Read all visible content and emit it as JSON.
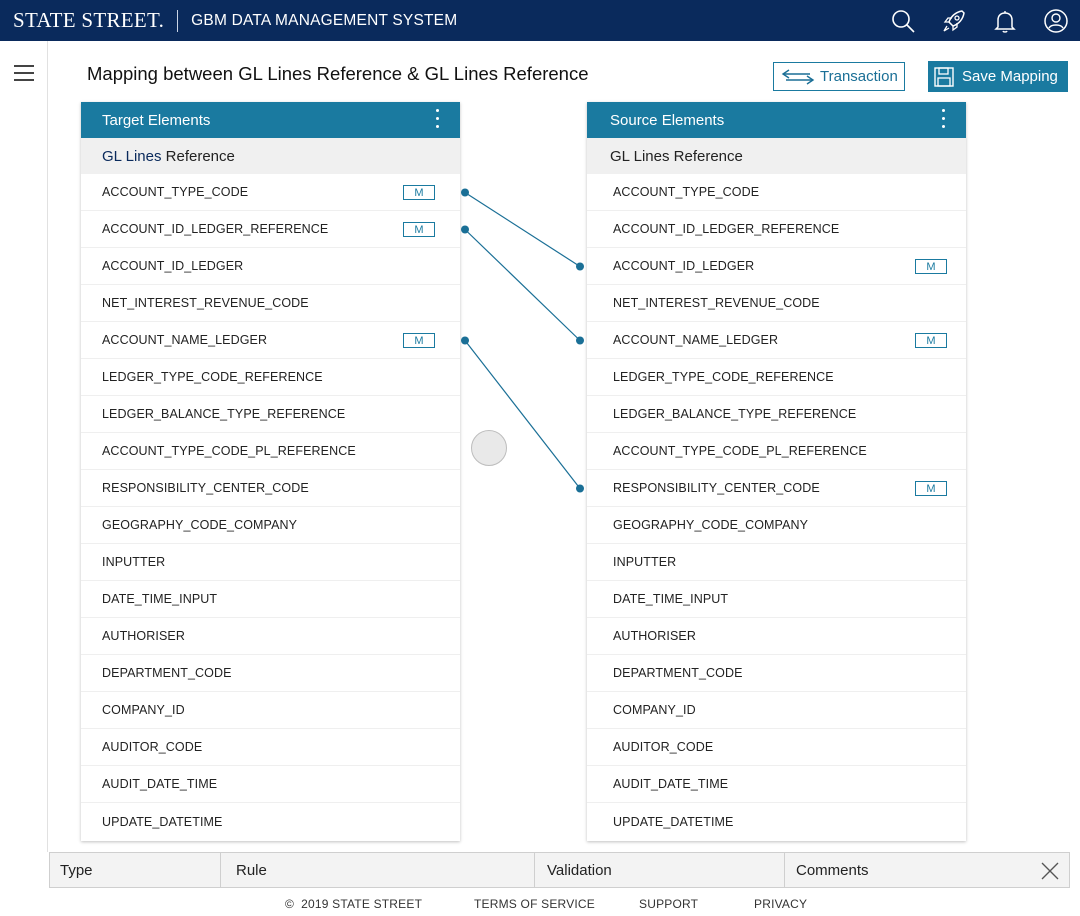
{
  "header": {
    "brand": "STATE STREET.",
    "system_name": "GBM DATA MANAGEMENT SYSTEM",
    "icons": [
      "search-icon",
      "rocket-icon",
      "bell-icon",
      "user-icon"
    ]
  },
  "page": {
    "title": "Mapping between GL Lines Reference & GL Lines Reference",
    "transaction_label": "Transaction",
    "save_label": "Save Mapping"
  },
  "target_panel": {
    "title": "Target Elements",
    "sub_prefix": "GL Lines",
    "sub_suffix": " Reference",
    "rows": [
      {
        "label": "ACCOUNT_TYPE_CODE",
        "badge": "M"
      },
      {
        "label": "ACCOUNT_ID_LEDGER_REFERENCE",
        "badge": "M"
      },
      {
        "label": "ACCOUNT_ID_LEDGER",
        "badge": ""
      },
      {
        "label": "NET_INTEREST_REVENUE_CODE",
        "badge": ""
      },
      {
        "label": "ACCOUNT_NAME_LEDGER",
        "badge": "M"
      },
      {
        "label": "LEDGER_TYPE_CODE_REFERENCE",
        "badge": ""
      },
      {
        "label": "LEDGER_BALANCE_TYPE_REFERENCE",
        "badge": ""
      },
      {
        "label": "ACCOUNT_TYPE_CODE_PL_REFERENCE",
        "badge": ""
      },
      {
        "label": "RESPONSIBILITY_CENTER_CODE",
        "badge": ""
      },
      {
        "label": "GEOGRAPHY_CODE_COMPANY",
        "badge": ""
      },
      {
        "label": "INPUTTER",
        "badge": ""
      },
      {
        "label": "DATE_TIME_INPUT",
        "badge": ""
      },
      {
        "label": "AUTHORISER",
        "badge": ""
      },
      {
        "label": "DEPARTMENT_CODE",
        "badge": ""
      },
      {
        "label": "COMPANY_ID",
        "badge": ""
      },
      {
        "label": "AUDITOR_CODE",
        "badge": ""
      },
      {
        "label": "AUDIT_DATE_TIME",
        "badge": ""
      },
      {
        "label": "UPDATE_DATETIME",
        "badge": ""
      }
    ]
  },
  "source_panel": {
    "title": "Source Elements",
    "sub": "GL Lines Reference",
    "rows": [
      {
        "label": "ACCOUNT_TYPE_CODE",
        "badge": ""
      },
      {
        "label": "ACCOUNT_ID_LEDGER_REFERENCE",
        "badge": ""
      },
      {
        "label": "ACCOUNT_ID_LEDGER",
        "badge": "M"
      },
      {
        "label": "NET_INTEREST_REVENUE_CODE",
        "badge": ""
      },
      {
        "label": "ACCOUNT_NAME_LEDGER",
        "badge": "M"
      },
      {
        "label": "LEDGER_TYPE_CODE_REFERENCE",
        "badge": ""
      },
      {
        "label": "LEDGER_BALANCE_TYPE_REFERENCE",
        "badge": ""
      },
      {
        "label": "ACCOUNT_TYPE_CODE_PL_REFERENCE",
        "badge": ""
      },
      {
        "label": "RESPONSIBILITY_CENTER_CODE",
        "badge": "M"
      },
      {
        "label": "GEOGRAPHY_CODE_COMPANY",
        "badge": ""
      },
      {
        "label": "INPUTTER",
        "badge": ""
      },
      {
        "label": "DATE_TIME_INPUT",
        "badge": ""
      },
      {
        "label": "AUTHORISER",
        "badge": ""
      },
      {
        "label": "DEPARTMENT_CODE",
        "badge": ""
      },
      {
        "label": "COMPANY_ID",
        "badge": ""
      },
      {
        "label": "AUDITOR_CODE",
        "badge": ""
      },
      {
        "label": "AUDIT_DATE_TIME",
        "badge": ""
      },
      {
        "label": "UPDATE_DATETIME",
        "badge": ""
      }
    ]
  },
  "mappings": [
    {
      "target_index": 0,
      "source_index": 2
    },
    {
      "target_index": 1,
      "source_index": 4
    },
    {
      "target_index": 4,
      "source_index": 8
    }
  ],
  "bottom_tabs": {
    "type": "Type",
    "rule": "Rule",
    "validation": "Validation",
    "comments": "Comments"
  },
  "footer": {
    "copyright": "©  2019 STATE STREET",
    "terms": "TERMS OF SERVICE",
    "support": "SUPPORT",
    "privacy": "PRIVACY"
  },
  "colors": {
    "header_bg": "#0a2a5c",
    "accent": "#1a7aa0",
    "connector": "#1a6f96"
  }
}
